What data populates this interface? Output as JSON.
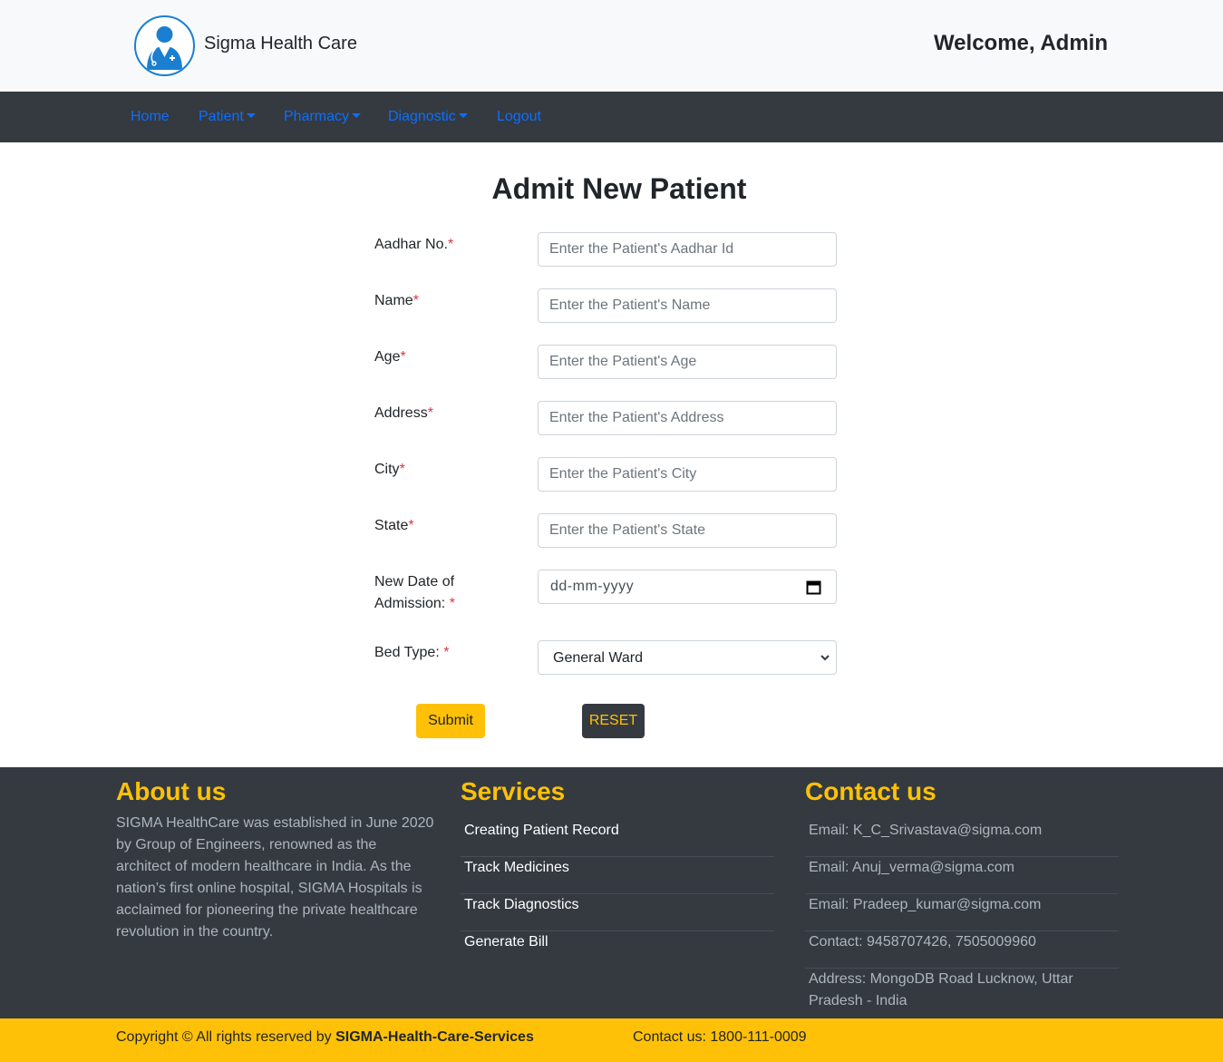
{
  "header": {
    "brand": "Sigma Health Care",
    "welcome": "Welcome, Admin"
  },
  "nav": {
    "items": [
      {
        "label": "Home",
        "dropdown": false
      },
      {
        "label": "Patient",
        "dropdown": true
      },
      {
        "label": "Pharmacy",
        "dropdown": true
      },
      {
        "label": "Diagnostic",
        "dropdown": true
      },
      {
        "label": "Logout",
        "dropdown": false
      }
    ]
  },
  "form": {
    "title": "Admit New Patient",
    "required_mark": "*",
    "fields": {
      "aadhar": {
        "label": "Aadhar No.",
        "placeholder": "Enter the Patient's Aadhar Id"
      },
      "name": {
        "label": "Name",
        "placeholder": "Enter the Patient's Name"
      },
      "age": {
        "label": "Age",
        "placeholder": "Enter the Patient's Age"
      },
      "address": {
        "label": "Address",
        "placeholder": "Enter the Patient's Address"
      },
      "city": {
        "label": "City",
        "placeholder": "Enter the Patient's City"
      },
      "state": {
        "label": "State",
        "placeholder": "Enter the Patient's State"
      },
      "admission_date": {
        "label_line1": "New Date of",
        "label_line2": "Admission: ",
        "placeholder": "dd-mm-yyyy"
      },
      "bed_type": {
        "label": "Bed Type: ",
        "value": "General Ward"
      }
    },
    "submit_label": "Submit",
    "reset_label": "RESET"
  },
  "footer": {
    "about": {
      "heading": "About us",
      "text": "SIGMA HealthCare was established in June 2020 by Group of Engineers, renowned as the architect of modern healthcare in India. As the nation’s first online hospital, SIGMA Hospitals is acclaimed for pioneering the private healthcare revolution in the country."
    },
    "services": {
      "heading": "Services",
      "items": [
        "Creating Patient Record",
        "Track Medicines",
        "Track Diagnostics",
        "Generate Bill"
      ]
    },
    "contact": {
      "heading": "Contact us",
      "items": [
        "Email: K_C_Srivastava@sigma.com",
        "Email: Anuj_verma@sigma.com",
        "Email: Pradeep_kumar@sigma.com",
        "Contact: 9458707426, 7505009960",
        "Address: MongoDB Road Lucknow, Uttar Pradesh - India"
      ]
    }
  },
  "copyright": {
    "prefix": "Copyright © All rights reserved by ",
    "org": "SIGMA-Health-Care-Services",
    "contact": "Contact us: 1800-111-0009"
  },
  "colors": {
    "accent": "#ffc107",
    "dark": "#343a40",
    "link": "#0d6efd",
    "required": "#dc3545"
  }
}
